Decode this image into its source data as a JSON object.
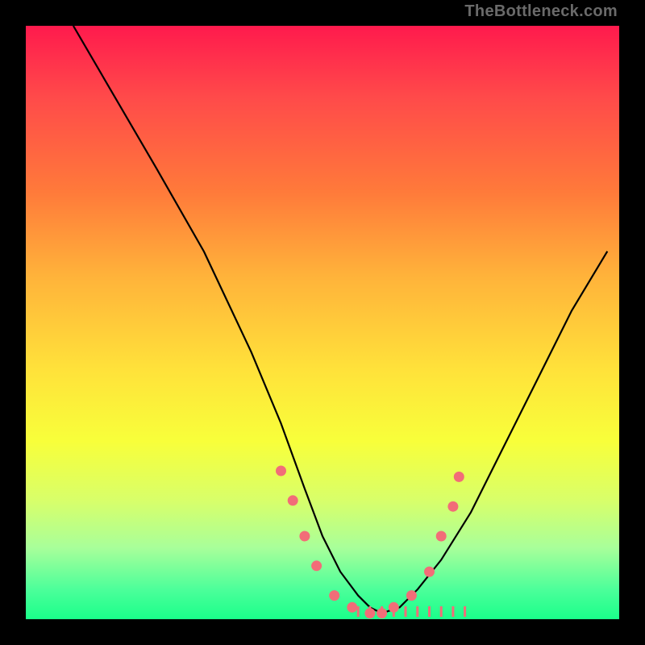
{
  "attribution": "TheBottleneck.com",
  "colors": {
    "background": "#000000",
    "gradient_top": "#ff1a4d",
    "gradient_bottom": "#1aff8a",
    "curve": "#000000",
    "markers": "#f26d78",
    "ticks": "#f26d78",
    "attribution_text": "#6a6a6a"
  },
  "chart_data": {
    "type": "line",
    "title": "",
    "xlabel": "",
    "ylabel": "",
    "xlim": [
      0,
      100
    ],
    "ylim": [
      0,
      100
    ],
    "grid": false,
    "legend": "none",
    "series": [
      {
        "name": "curve",
        "x": [
          8,
          15,
          22,
          30,
          38,
          43,
          47,
          50,
          53,
          56,
          58,
          60,
          63,
          66,
          70,
          75,
          80,
          86,
          92,
          98
        ],
        "y": [
          100,
          88,
          76,
          62,
          45,
          33,
          22,
          14,
          8,
          4,
          2,
          1,
          2,
          5,
          10,
          18,
          28,
          40,
          52,
          62
        ]
      }
    ],
    "markers": [
      {
        "x": 43,
        "y": 25
      },
      {
        "x": 45,
        "y": 20
      },
      {
        "x": 47,
        "y": 14
      },
      {
        "x": 49,
        "y": 9
      },
      {
        "x": 52,
        "y": 4
      },
      {
        "x": 55,
        "y": 2
      },
      {
        "x": 58,
        "y": 1
      },
      {
        "x": 60,
        "y": 1
      },
      {
        "x": 62,
        "y": 2
      },
      {
        "x": 65,
        "y": 4
      },
      {
        "x": 68,
        "y": 8
      },
      {
        "x": 70,
        "y": 14
      },
      {
        "x": 72,
        "y": 19
      },
      {
        "x": 73,
        "y": 24
      }
    ],
    "ticks_x": [
      56,
      58,
      60,
      62,
      64,
      66,
      68,
      70,
      72,
      74
    ]
  }
}
